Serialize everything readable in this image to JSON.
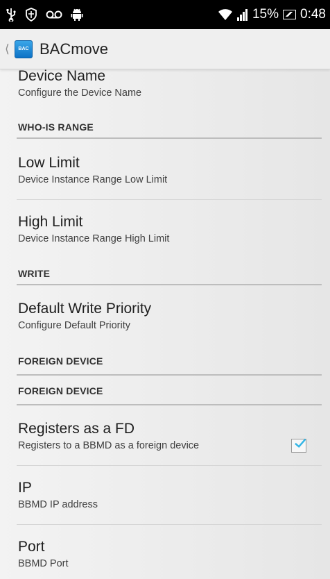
{
  "status_bar": {
    "battery": "15%",
    "time": "0:48"
  },
  "action_bar": {
    "logo_text": "BAC",
    "title": "BACmove"
  },
  "settings": {
    "device_name": {
      "title": "Device Name",
      "summary": "Configure the Device Name"
    },
    "who_is_category": "WHO-IS RANGE",
    "low_limit": {
      "title": "Low Limit",
      "summary": "Device Instance Range Low Limit"
    },
    "high_limit": {
      "title": "High Limit",
      "summary": "Device Instance Range High Limit"
    },
    "write_category": "WRITE",
    "default_write_priority": {
      "title": "Default Write Priority",
      "summary": "Configure Default Priority"
    },
    "foreign_device_category_1": "FOREIGN DEVICE",
    "foreign_device_category_2": "FOREIGN DEVICE",
    "registers_fd": {
      "title": "Registers as a FD",
      "summary": "Registers to a BBMD as a foreign device",
      "checked": true
    },
    "ip": {
      "title": "IP",
      "summary": "BBMD IP address"
    },
    "port": {
      "title": "Port",
      "summary": "BBMD Port"
    }
  },
  "colors": {
    "accent": "#33b5e5",
    "status_bar_bg": "#000000",
    "action_bar_bg": "#efefef"
  }
}
